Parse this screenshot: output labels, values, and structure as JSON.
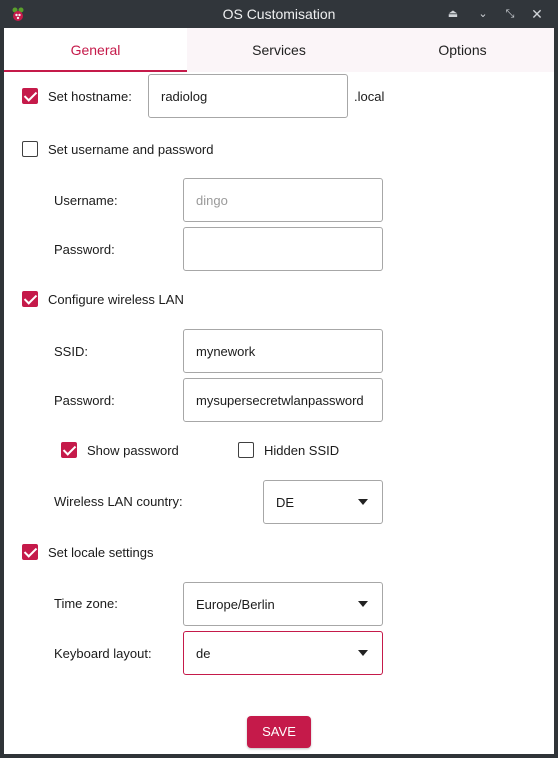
{
  "window": {
    "title": "OS Customisation",
    "accent_color": "#c51a4a",
    "icons": [
      "raspberry-pi-icon",
      "keep-above-icon",
      "minimize-icon",
      "restore-icon",
      "close-icon"
    ]
  },
  "tabs": [
    {
      "label": "General",
      "active": true
    },
    {
      "label": "Services",
      "active": false
    },
    {
      "label": "Options",
      "active": false
    }
  ],
  "general": {
    "hostname": {
      "checkbox_label": "Set hostname:",
      "checked": true,
      "value": "radiolog",
      "suffix": ".local"
    },
    "user": {
      "checkbox_label": "Set username and password",
      "checked": false,
      "username_label": "Username:",
      "username_placeholder": "dingo",
      "username_value": "",
      "password_label": "Password:",
      "password_value": ""
    },
    "wlan": {
      "checkbox_label": "Configure wireless LAN",
      "checked": true,
      "ssid_label": "SSID:",
      "ssid_value": "mynework",
      "password_label": "Password:",
      "password_value": "mysupersecretwlanpassword",
      "show_password_label": "Show password",
      "show_password_checked": true,
      "hidden_ssid_label": "Hidden SSID",
      "hidden_ssid_checked": false,
      "country_label": "Wireless LAN country:",
      "country_value": "DE"
    },
    "locale": {
      "checkbox_label": "Set locale settings",
      "checked": true,
      "timezone_label": "Time zone:",
      "timezone_value": "Europe/Berlin",
      "keyboard_label": "Keyboard layout:",
      "keyboard_value": "de"
    }
  },
  "actions": {
    "save_label": "SAVE"
  }
}
